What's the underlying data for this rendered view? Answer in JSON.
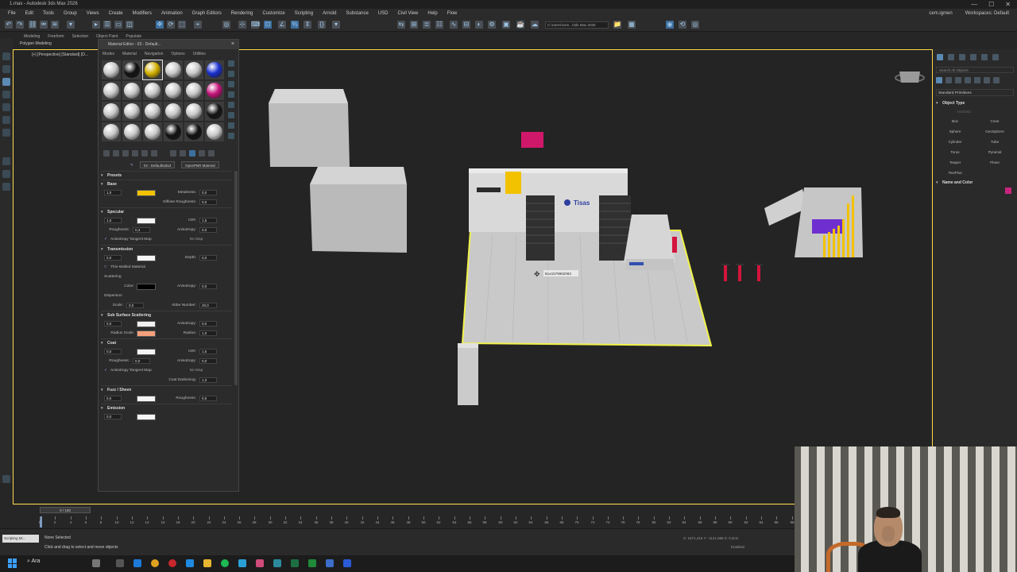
{
  "window": {
    "title": "1.max - Autodesk 3ds Max 2026",
    "controls": [
      "—",
      "☐",
      "✕"
    ]
  },
  "menu": [
    "File",
    "Edit",
    "Tools",
    "Group",
    "Views",
    "Create",
    "Modifiers",
    "Animation",
    "Graph Editors",
    "Rendering",
    "Customize",
    "Scripting",
    "Arnold",
    "Substance",
    "USD",
    "Civil View",
    "Help",
    "Flow"
  ],
  "user": {
    "name": "cem.igmen",
    "workspace_label": "Workspaces:",
    "workspace": "Default"
  },
  "toolbar": {
    "path": "C:\\Users\\cem...\\3ds Max 2026"
  },
  "ribbon": {
    "tabs": [
      "Modeling",
      "Freeform",
      "Selection",
      "Object Paint",
      "Populate"
    ],
    "sub": "Polygon Modeling"
  },
  "viewport": {
    "label": "[+] [Perspective] [Standard] [D...",
    "tooltip": "Box1579962083"
  },
  "material_editor": {
    "title": "Material Editor - 03 - Default...",
    "menu": [
      "Modes",
      "Material",
      "Navigation",
      "Options",
      "Utilities"
    ],
    "slot_name": "03 - Default/adsd",
    "slot_type": "OpenPBR Material",
    "spheres": [
      "#c9c9c9",
      "#111111",
      "#d4b000",
      "#c9c9c9",
      "#c9c9c9",
      "#1a2fd0",
      "#c9c9c9",
      "#c9c9c9",
      "#c9c9c9",
      "#c9c9c9",
      "#c9c9c9",
      "#c4127a",
      "#c9c9c9",
      "#c9c9c9",
      "#c9c9c9",
      "#c9c9c9",
      "#c9c9c9",
      "#141414",
      "#c9c9c9",
      "#c9c9c9",
      "#c9c9c9",
      "#111111",
      "#111111",
      "#c9c9c9"
    ],
    "selected_index": 2,
    "sections": {
      "presets": "Presets",
      "base": {
        "title": "Base",
        "weight": "1,0",
        "color": "#f2c200",
        "metalness_label": "Metalness:",
        "metalness": "0,0",
        "diffuse_label": "Diffuse Roughness:",
        "diffuse": "0,0"
      },
      "specular": {
        "title": "Specular",
        "weight": "1,0",
        "color": "#f5f5f5",
        "ior_label": "IOR:",
        "ior": "1,5",
        "rough_label": "Roughness:",
        "rough": "0,3",
        "aniso_label": "Anisotropy:",
        "aniso": "0,0",
        "tangent": "Anisotropy Tangent Map",
        "nomap": "No Map"
      },
      "transmission": {
        "title": "Transmission",
        "weight": "0,0",
        "color": "#f5f5f5",
        "depth_label": "Depth:",
        "depth": "0,0",
        "thin": "Thin-Walled Material",
        "scattering": "Scattering",
        "color_label": "Color:",
        "scatter_color": "#000000",
        "aniso_label": "Anisotropy:",
        "aniso": "0,0",
        "dispersion": "Dispersion",
        "scale_label": "Scale:",
        "scale": "0,0",
        "abbe_label": "Abbe Number:",
        "abbe": "20,0"
      },
      "sss": {
        "title": "Sub Surface Scattering",
        "weight": "0,0",
        "color": "#f0f0f0",
        "aniso_label": "Anisotropy:",
        "aniso": "0,0",
        "radius_scale_label": "Radius Scale:",
        "radius_color": "#f4a07c",
        "radius_label": "Radius:",
        "radius": "1,0"
      },
      "coat": {
        "title": "Coat",
        "weight": "0,0",
        "color": "#f5f5f5",
        "ior_label": "IOR:",
        "ior": "1,6",
        "rough_label": "Roughness:",
        "rough": "0,0",
        "aniso_label": "Anisotropy:",
        "aniso": "0,0",
        "tangent": "Anisotropy Tangent Map",
        "nomap": "No Map",
        "darken_label": "Coat Darkening:",
        "darken": "1,0"
      },
      "fuzz": {
        "title": "Fuzz / Sheen",
        "weight": "0,0",
        "color": "#f5f5f5",
        "rough_label": "Roughness:",
        "rough": "0,5"
      },
      "emission": {
        "title": "Emission",
        "weight": "0,0",
        "color": "#f5f5f5"
      }
    }
  },
  "command_panel": {
    "search": "Search All Objects",
    "category": "Standard Primitives",
    "object_type": "Object Type",
    "autogrid": "AutoGrid",
    "buttons": [
      "Box",
      "Cone",
      "Sphere",
      "GeoSphere",
      "Cylinder",
      "Tube",
      "Torus",
      "Pyramid",
      "Teapot",
      "Plane",
      "TextPlus"
    ],
    "name_color": "Name and Color",
    "color": "#c8247f"
  },
  "timeline": {
    "slider": "0 / 100",
    "ticks": [
      0,
      2,
      4,
      6,
      8,
      10,
      12,
      14,
      16,
      18,
      20,
      22,
      24,
      26,
      28,
      30,
      32,
      34,
      36,
      38,
      40,
      42,
      44,
      46,
      48,
      50,
      52,
      54,
      56,
      58,
      60,
      62,
      64,
      66,
      68,
      70,
      72,
      74,
      76,
      78,
      80,
      82,
      84,
      86,
      88,
      90,
      92,
      94,
      96,
      98
    ]
  },
  "status": {
    "script": "Scripting Mi...",
    "selection": "None Selected",
    "hint": "Click and drag to select and move objects",
    "coords": "X: 1671,415   Y: -1121,988   Z: 0,0cm",
    "enabled": "Enabled:"
  },
  "taskbar": {
    "search": "Ara"
  },
  "scene": {
    "logo_text": "Tisas",
    "accent": "#f2c200",
    "selection": "#f0f24a",
    "red": "#d4143c",
    "pink": "#d0186a",
    "purple": "#6f2fd0"
  }
}
